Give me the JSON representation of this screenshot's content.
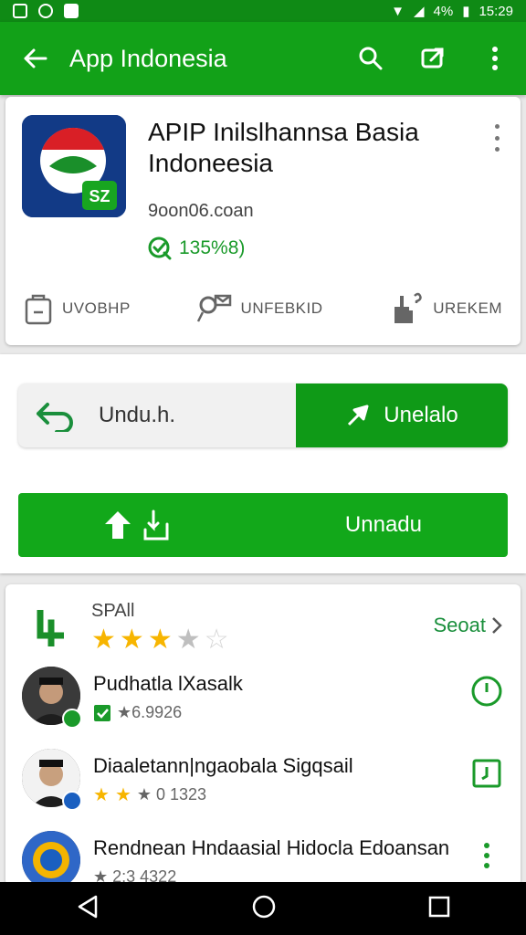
{
  "status_bar": {
    "time": "15:29",
    "battery_text": "4%"
  },
  "toolbar": {
    "title": "App Indonesia"
  },
  "app": {
    "title": "APIP Inilslhannsa Basia Indoneesia",
    "developer": "9oon06.coan",
    "rating_text": "135%8)"
  },
  "info": [
    {
      "label": "UVOBHP",
      "icon": "bag-icon"
    },
    {
      "label": "UNFEBKID",
      "icon": "mail-icon"
    },
    {
      "label": "UREKEM",
      "icon": "hand-icon"
    }
  ],
  "actions": {
    "split_left_label": "Undu.h.",
    "split_right_label": "Unelalo",
    "big_button_label": "Unnadu"
  },
  "section": {
    "title": "SPAll",
    "see_all": "Seoat",
    "rating_stars": 3.5
  },
  "list": [
    {
      "title": "Pudhatla lXasalk",
      "meta": "★6.9926",
      "badge_color": "#1a9a2a",
      "action_icon": "clock-icon"
    },
    {
      "title": "Diaaletann|ngaobala Sigqsail",
      "meta": "★ 0 1323",
      "badge_color": "#1a5fc0",
      "action_icon": "calendar-icon"
    },
    {
      "title": "Rendnean Hndaasial Hidocla Edoansan",
      "meta": "★ 2:3 4322",
      "badge_color": "#1a5fc0",
      "action_icon": "more-icon"
    }
  ],
  "colors": {
    "primary": "#12a118",
    "primary_dark": "#0f8a15",
    "accent_green": "#1a9a2a"
  }
}
